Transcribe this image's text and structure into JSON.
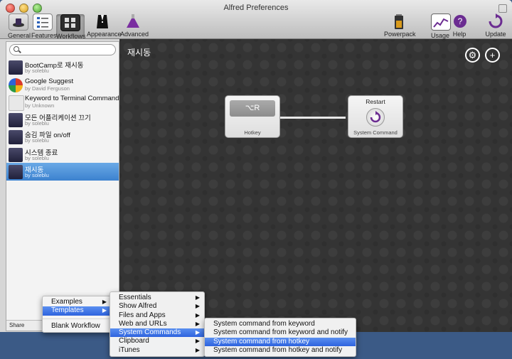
{
  "window": {
    "title": "Alfred Preferences"
  },
  "toolbar": {
    "general": "General",
    "features": "Features",
    "workflows": "Workflows",
    "appearance": "Appearance",
    "advanced": "Advanced",
    "powerpack": "Powerpack",
    "usage": "Usage",
    "help": "Help",
    "update": "Update"
  },
  "sidebar": {
    "search_value": "",
    "items": [
      {
        "name": "BootCamp로 재시동",
        "author": "by soleblu"
      },
      {
        "name": "Google Suggest",
        "author": "by David Ferguson"
      },
      {
        "name": "Keyword to Terminal Command",
        "author": "by Unknown"
      },
      {
        "name": "모든 어플리케이션 끄기",
        "author": "by soleblu"
      },
      {
        "name": "숨김 파일  on/off",
        "author": "by soleblu"
      },
      {
        "name": "시스템 종료",
        "author": "by soleblu"
      },
      {
        "name": "재시동",
        "author": "by soleblu"
      }
    ],
    "share": "Share"
  },
  "canvas": {
    "title": "재시동",
    "hotkey_node": {
      "key": "⌥R",
      "label": "Hotkey"
    },
    "restart_node": {
      "title": "Restart",
      "label": "System Command"
    }
  },
  "menus": {
    "root": {
      "examples": "Examples",
      "templates": "Templates",
      "blank": "Blank Workflow"
    },
    "templates": [
      "Essentials",
      "Show Alfred",
      "Files and Apps",
      "Web and URLs",
      "System Commands",
      "Clipboard",
      "iTunes"
    ],
    "system_commands": [
      "System command from keyword",
      "System command from keyword and notify",
      "System command from hotkey",
      "System command from hotkey and notify"
    ]
  },
  "colors": {
    "accent": "#3c82cf",
    "canvas": "#343434",
    "highlight": "#2e63de",
    "alfred_purple": "#6b2c91"
  }
}
